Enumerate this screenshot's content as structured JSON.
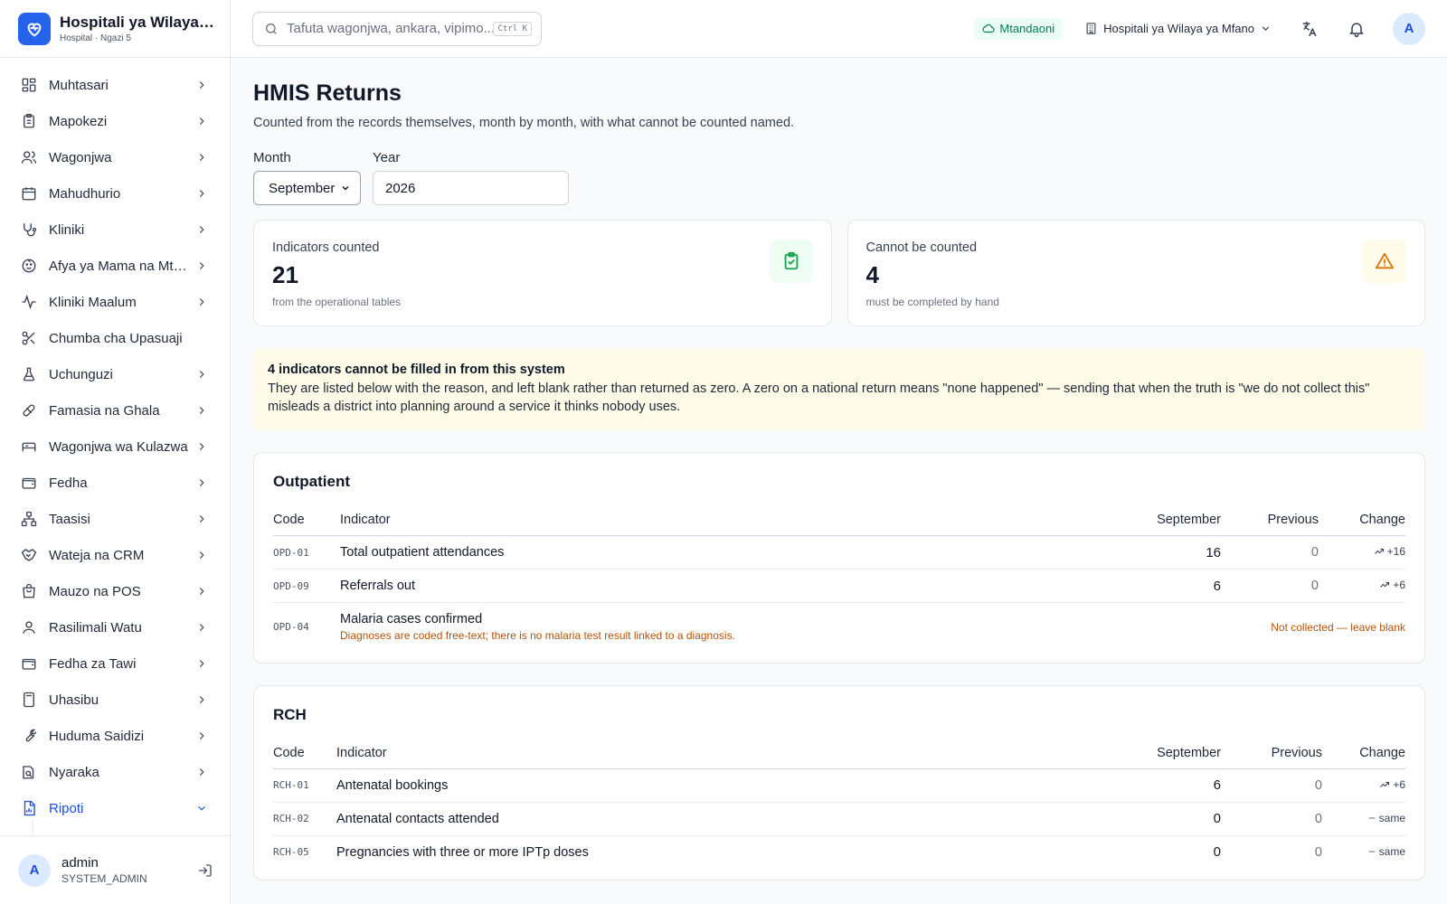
{
  "brand": {
    "title": "Hospitali ya Wilaya ya Mfano",
    "subtitle": "Hospital · Ngazi 5"
  },
  "search": {
    "placeholder": "Tafuta wagonjwa, ankara, vipimo...",
    "shortcut": "Ctrl K"
  },
  "topbar": {
    "status": "Mtandaoni",
    "facility": "Hospitali ya Wilaya ya Mfano",
    "avatar": "A"
  },
  "sidebar": {
    "items": [
      {
        "label": "Muhtasari",
        "icon": "dashboard-icon"
      },
      {
        "label": "Mapokezi",
        "icon": "clipboard-icon"
      },
      {
        "label": "Wagonjwa",
        "icon": "users-icon"
      },
      {
        "label": "Mahudhurio",
        "icon": "calendar-icon"
      },
      {
        "label": "Kliniki",
        "icon": "stethoscope-icon"
      },
      {
        "label": "Afya ya Mama na Mtoto",
        "icon": "baby-icon"
      },
      {
        "label": "Kliniki Maalum",
        "icon": "activity-icon"
      },
      {
        "label": "Chumba cha Upasuaji",
        "icon": "scissors-icon"
      },
      {
        "label": "Uchunguzi",
        "icon": "flask-icon"
      },
      {
        "label": "Famasia na Ghala",
        "icon": "pill-icon"
      },
      {
        "label": "Wagonjwa wa Kulazwa",
        "icon": "bed-icon"
      },
      {
        "label": "Fedha",
        "icon": "wallet-icon"
      },
      {
        "label": "Taasisi",
        "icon": "network-icon"
      },
      {
        "label": "Wateja na CRM",
        "icon": "handshake-icon"
      },
      {
        "label": "Mauzo na POS",
        "icon": "shopping-bag-icon"
      },
      {
        "label": "Rasilimali Watu",
        "icon": "user-icon"
      },
      {
        "label": "Fedha za Tawi",
        "icon": "wallet-icon"
      },
      {
        "label": "Uhasibu",
        "icon": "calculator-icon"
      },
      {
        "label": "Huduma Saidizi",
        "icon": "wrench-icon"
      },
      {
        "label": "Nyaraka",
        "icon": "folder-icon"
      },
      {
        "label": "Ripoti",
        "icon": "report-icon"
      }
    ]
  },
  "user": {
    "initial": "A",
    "name": "admin",
    "role": "SYSTEM_ADMIN"
  },
  "page": {
    "title": "HMIS Returns",
    "subtitle": "Counted from the records themselves, month by month, with what cannot be counted named."
  },
  "filters": {
    "month_label": "Month",
    "month_value": "September",
    "year_label": "Year",
    "year_value": "2026"
  },
  "stats": {
    "counted": {
      "label": "Indicators counted",
      "value": "21",
      "note": "from the operational tables"
    },
    "uncounted": {
      "label": "Cannot be counted",
      "value": "4",
      "note": "must be completed by hand"
    }
  },
  "warning": {
    "title": "4 indicators cannot be filled in from this system",
    "body": "They are listed below with the reason, and left blank rather than returned as zero. A zero on a national return means \"none happened\" — sending that when the truth is \"we do not collect this\" misleads a district into planning around a service it thinks nobody uses."
  },
  "outpatient": {
    "title": "Outpatient",
    "columns": {
      "code": "Code",
      "indicator": "Indicator",
      "current": "September",
      "previous": "Previous",
      "change": "Change"
    },
    "rows": [
      {
        "code": "OPD-01",
        "indicator": "Total outpatient attendances",
        "current": "16",
        "previous": "0",
        "change": "+16"
      },
      {
        "code": "OPD-09",
        "indicator": "Referrals out",
        "current": "6",
        "previous": "0",
        "change": "+6"
      },
      {
        "code": "OPD-04",
        "indicator": "Malaria cases confirmed",
        "reason": "Diagnoses are coded free-text; there is no malaria test result linked to a diagnosis.",
        "status": "Not collected — leave blank"
      }
    ]
  },
  "rch": {
    "title": "RCH",
    "columns": {
      "code": "Code",
      "indicator": "Indicator",
      "current": "September",
      "previous": "Previous",
      "change": "Change"
    },
    "rows": [
      {
        "code": "RCH-01",
        "indicator": "Antenatal bookings",
        "current": "6",
        "previous": "0",
        "change": "+6"
      },
      {
        "code": "RCH-02",
        "indicator": "Antenatal contacts attended",
        "current": "0",
        "previous": "0",
        "change": "same"
      },
      {
        "code": "RCH-05",
        "indicator": "Pregnancies with three or more IPTp doses",
        "current": "0",
        "previous": "0",
        "change": "same"
      }
    ]
  },
  "colors": {
    "accent": "#2563eb",
    "success": "#16a34a",
    "warning": "#d97706",
    "warning_bg": "#fefce8"
  }
}
